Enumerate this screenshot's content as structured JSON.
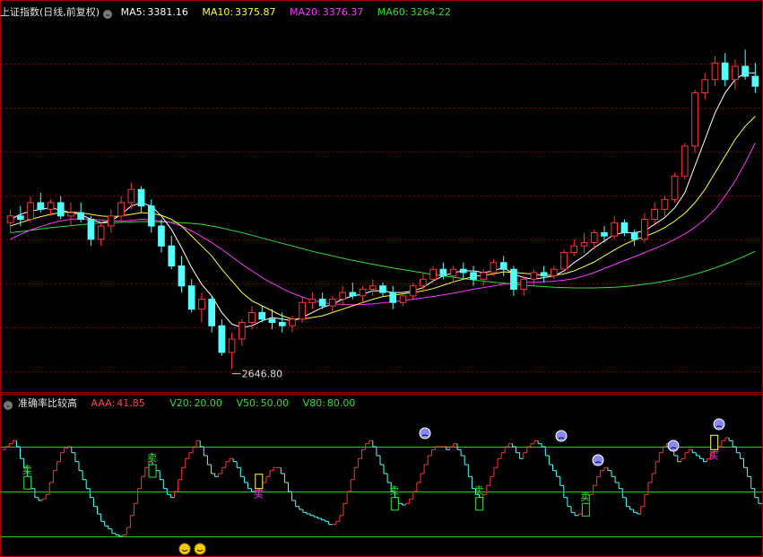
{
  "main_panel": {
    "title": "上证指数(日线,前复权)",
    "ma": [
      {
        "label": "MA5:",
        "value": "3381.16",
        "color": "#ffffff"
      },
      {
        "label": "MA10:",
        "value": "3375.87",
        "color": "#ffff33"
      },
      {
        "label": "MA20:",
        "value": "3376.37",
        "color": "#ff33ff"
      },
      {
        "label": "MA60:",
        "value": "3264.22",
        "color": "#33dd33"
      }
    ],
    "low_label": "2646.80"
  },
  "sub_panel": {
    "title": "准确率比较高",
    "indicators": [
      {
        "label": "AAA:",
        "value": "41.85",
        "color": "#ff4444"
      },
      {
        "label": "V20:",
        "value": "20.00",
        "color": "#33dd33"
      },
      {
        "label": "V50:",
        "value": "50.00",
        "color": "#33dd33"
      },
      {
        "label": "V80:",
        "value": "80.00",
        "color": "#33dd33"
      }
    ],
    "sell_text": "卖",
    "buy_text": "买"
  },
  "colors": {
    "up": "#ff3333",
    "down": "#54ffff",
    "ma5": "#ffffff",
    "ma10": "#ffff33",
    "ma20": "#ff33ff",
    "ma60": "#33dd33",
    "grid": "#8b0000",
    "border": "#a00000",
    "level": "#22cc22",
    "sell": "#33dd33",
    "buy": "#ff33ff"
  },
  "chart_data": [
    {
      "type": "candlestick",
      "title": "上证指数(日线,前复权)",
      "ylim": [
        2600,
        3700
      ],
      "low_marker": 2646.8,
      "candles": [
        [
          3090,
          3130,
          3060,
          3110
        ],
        [
          3110,
          3140,
          3080,
          3100
        ],
        [
          3100,
          3170,
          3090,
          3150
        ],
        [
          3150,
          3180,
          3120,
          3130
        ],
        [
          3130,
          3160,
          3110,
          3150
        ],
        [
          3150,
          3170,
          3100,
          3110
        ],
        [
          3110,
          3150,
          3080,
          3120
        ],
        [
          3120,
          3150,
          3090,
          3100
        ],
        [
          3100,
          3110,
          3020,
          3040
        ],
        [
          3040,
          3090,
          3020,
          3080
        ],
        [
          3080,
          3130,
          3060,
          3110
        ],
        [
          3110,
          3170,
          3090,
          3150
        ],
        [
          3150,
          3210,
          3130,
          3190
        ],
        [
          3190,
          3200,
          3120,
          3140
        ],
        [
          3140,
          3160,
          3060,
          3080
        ],
        [
          3080,
          3100,
          3000,
          3020
        ],
        [
          3020,
          3050,
          2950,
          2960
        ],
        [
          2960,
          2990,
          2880,
          2900
        ],
        [
          2900,
          2920,
          2820,
          2830
        ],
        [
          2830,
          2880,
          2790,
          2860
        ],
        [
          2860,
          2870,
          2760,
          2780
        ],
        [
          2780,
          2800,
          2690,
          2700
        ],
        [
          2700,
          2760,
          2650,
          2740
        ],
        [
          2740,
          2800,
          2720,
          2790
        ],
        [
          2790,
          2840,
          2770,
          2820
        ],
        [
          2820,
          2840,
          2790,
          2800
        ],
        [
          2800,
          2830,
          2770,
          2790
        ],
        [
          2790,
          2820,
          2760,
          2780
        ],
        [
          2780,
          2810,
          2760,
          2800
        ],
        [
          2800,
          2870,
          2790,
          2850
        ],
        [
          2850,
          2880,
          2830,
          2860
        ],
        [
          2860,
          2880,
          2830,
          2840
        ],
        [
          2840,
          2870,
          2820,
          2860
        ],
        [
          2860,
          2900,
          2840,
          2880
        ],
        [
          2880,
          2910,
          2860,
          2870
        ],
        [
          2870,
          2900,
          2850,
          2890
        ],
        [
          2890,
          2920,
          2870,
          2900
        ],
        [
          2900,
          2910,
          2870,
          2880
        ],
        [
          2880,
          2900,
          2830,
          2850
        ],
        [
          2850,
          2880,
          2840,
          2870
        ],
        [
          2870,
          2910,
          2860,
          2900
        ],
        [
          2900,
          2940,
          2880,
          2920
        ],
        [
          2920,
          2960,
          2910,
          2950
        ],
        [
          2950,
          2970,
          2920,
          2930
        ],
        [
          2930,
          2960,
          2910,
          2950
        ],
        [
          2950,
          2970,
          2920,
          2940
        ],
        [
          2940,
          2960,
          2900,
          2920
        ],
        [
          2920,
          2950,
          2900,
          2940
        ],
        [
          2940,
          2980,
          2930,
          2970
        ],
        [
          2970,
          2990,
          2930,
          2950
        ],
        [
          2950,
          2960,
          2870,
          2890
        ],
        [
          2890,
          2930,
          2870,
          2920
        ],
        [
          2920,
          2950,
          2900,
          2940
        ],
        [
          2940,
          2960,
          2910,
          2930
        ],
        [
          2930,
          2960,
          2920,
          2950
        ],
        [
          2950,
          3010,
          2940,
          3000
        ],
        [
          3000,
          3040,
          2990,
          3020
        ],
        [
          3020,
          3060,
          3000,
          3030
        ],
        [
          3030,
          3070,
          3010,
          3060
        ],
        [
          3060,
          3080,
          3030,
          3050
        ],
        [
          3050,
          3110,
          3040,
          3090
        ],
        [
          3090,
          3100,
          3050,
          3060
        ],
        [
          3060,
          3070,
          3020,
          3040
        ],
        [
          3040,
          3120,
          3030,
          3100
        ],
        [
          3100,
          3150,
          3080,
          3130
        ],
        [
          3130,
          3170,
          3110,
          3160
        ],
        [
          3160,
          3240,
          3150,
          3230
        ],
        [
          3230,
          3330,
          3220,
          3320
        ],
        [
          3320,
          3490,
          3300,
          3480
        ],
        [
          3480,
          3540,
          3460,
          3520
        ],
        [
          3520,
          3590,
          3500,
          3570
        ],
        [
          3570,
          3600,
          3500,
          3520
        ],
        [
          3520,
          3580,
          3490,
          3560
        ],
        [
          3560,
          3610,
          3520,
          3530
        ],
        [
          3530,
          3570,
          3480,
          3500
        ]
      ],
      "series": [
        {
          "name": "MA5",
          "values": [
            3100,
            3115,
            3125,
            3130,
            3135,
            3128,
            3120,
            3115,
            3100,
            3090,
            3095,
            3115,
            3140,
            3150,
            3140,
            3110,
            3070,
            3015,
            2955,
            2905,
            2870,
            2820,
            2785,
            2775,
            2780,
            2795,
            2805,
            2800,
            2795,
            2805,
            2820,
            2835,
            2845,
            2860,
            2870,
            2875,
            2885,
            2885,
            2880,
            2880,
            2885,
            2895,
            2915,
            2930,
            2940,
            2945,
            2945,
            2940,
            2945,
            2955,
            2935,
            2925,
            2920,
            2925,
            2930,
            2945,
            2970,
            2990,
            3015,
            3035,
            3055,
            3060,
            3060,
            3065,
            3085,
            3105,
            3135,
            3180,
            3260,
            3340,
            3420,
            3480,
            3520,
            3540,
            3540
          ]
        },
        {
          "name": "MA10",
          "values": [
            3080,
            3090,
            3100,
            3108,
            3115,
            3120,
            3122,
            3120,
            3115,
            3110,
            3108,
            3110,
            3115,
            3120,
            3118,
            3112,
            3100,
            3080,
            3050,
            3020,
            2990,
            2950,
            2915,
            2880,
            2855,
            2840,
            2825,
            2810,
            2800,
            2800,
            2805,
            2810,
            2820,
            2830,
            2840,
            2850,
            2860,
            2868,
            2872,
            2876,
            2880,
            2885,
            2892,
            2902,
            2912,
            2920,
            2928,
            2932,
            2936,
            2942,
            2940,
            2938,
            2935,
            2932,
            2932,
            2936,
            2945,
            2958,
            2972,
            2990,
            3008,
            3025,
            3038,
            3048,
            3060,
            3075,
            3095,
            3118,
            3150,
            3190,
            3240,
            3290,
            3340,
            3380,
            3410
          ]
        },
        {
          "name": "MA20",
          "values": [
            3040,
            3055,
            3068,
            3078,
            3088,
            3095,
            3100,
            3102,
            3100,
            3098,
            3095,
            3095,
            3097,
            3100,
            3098,
            3095,
            3090,
            3080,
            3065,
            3048,
            3030,
            3010,
            2988,
            2965,
            2945,
            2925,
            2908,
            2892,
            2878,
            2866,
            2857,
            2850,
            2846,
            2844,
            2843,
            2844,
            2846,
            2849,
            2852,
            2856,
            2860,
            2864,
            2868,
            2873,
            2878,
            2884,
            2890,
            2895,
            2900,
            2905,
            2908,
            2910,
            2911,
            2912,
            2914,
            2917,
            2922,
            2930,
            2940,
            2952,
            2964,
            2976,
            2988,
            3000,
            3012,
            3025,
            3040,
            3056,
            3076,
            3100,
            3130,
            3170,
            3215,
            3270,
            3330
          ]
        },
        {
          "name": "MA60",
          "values": [
            3060,
            3063,
            3067,
            3071,
            3075,
            3078,
            3081,
            3084,
            3087,
            3089,
            3090,
            3091,
            3092,
            3093,
            3093,
            3092,
            3091,
            3090,
            3088,
            3085,
            3080,
            3074,
            3067,
            3060,
            3052,
            3044,
            3036,
            3028,
            3020,
            3012,
            3004,
            2997,
            2990,
            2983,
            2977,
            2971,
            2965,
            2959,
            2954,
            2949,
            2944,
            2939,
            2934,
            2930,
            2926,
            2922,
            2918,
            2914,
            2911,
            2908,
            2905,
            2902,
            2900,
            2898,
            2896,
            2895,
            2894,
            2894,
            2894,
            2895,
            2896,
            2898,
            2901,
            2905,
            2909,
            2914,
            2920,
            2927,
            2935,
            2944,
            2954,
            2965,
            2977,
            2990,
            3004
          ]
        }
      ]
    },
    {
      "type": "step-line",
      "title": "准确率比较高",
      "ylim": [
        0,
        100
      ],
      "levels": [
        20,
        50,
        80
      ],
      "series": [
        {
          "name": "AAA",
          "values": [
            78,
            80,
            82,
            84,
            80,
            72,
            66,
            60,
            52,
            46,
            44,
            45,
            48,
            56,
            64,
            70,
            76,
            79,
            80,
            76,
            70,
            64,
            58,
            52,
            46,
            40,
            35,
            30,
            27,
            25,
            22,
            21,
            20,
            21,
            26,
            34,
            42,
            52,
            60,
            66,
            70,
            68,
            64,
            58,
            52,
            48,
            46,
            50,
            58,
            66,
            72,
            76,
            80,
            84,
            80,
            74,
            68,
            62,
            60,
            62,
            66,
            70,
            72,
            70,
            66,
            60,
            56,
            52,
            50,
            50,
            52,
            56,
            60,
            64,
            66,
            66,
            62,
            56,
            50,
            44,
            40,
            38,
            36,
            35,
            34,
            33,
            32,
            31,
            30,
            28,
            28,
            30,
            34,
            42,
            50,
            58,
            66,
            72,
            78,
            82,
            84,
            80,
            74,
            68,
            62,
            56,
            50,
            46,
            42,
            41,
            42,
            45,
            50,
            56,
            62,
            68,
            74,
            78,
            80,
            80,
            80,
            78,
            80,
            82,
            78,
            74,
            68,
            60,
            52,
            48,
            46,
            48,
            54,
            60,
            66,
            72,
            76,
            80,
            82,
            80,
            76,
            72,
            76,
            80,
            82,
            84,
            82,
            80,
            74,
            68,
            64,
            60,
            54,
            46,
            40,
            36,
            34,
            35,
            38,
            42,
            48,
            54,
            60,
            64,
            66,
            64,
            60,
            56,
            52,
            46,
            40,
            38,
            36,
            35,
            40,
            48,
            56,
            62,
            70,
            76,
            80,
            82,
            80,
            74,
            70,
            72,
            76,
            78,
            76,
            74,
            72,
            70,
            72,
            76,
            78,
            80,
            84,
            86,
            84,
            80,
            76,
            72,
            66,
            60,
            52,
            46,
            42
          ]
        },
        {
          "name": "V20",
          "values": [
            20
          ]
        },
        {
          "name": "V50",
          "values": [
            50
          ]
        },
        {
          "name": "V80",
          "values": [
            80
          ]
        }
      ],
      "sell_signals": [
        7,
        41,
        107,
        130,
        159,
        213,
        238,
        254
      ],
      "buy_signals": [
        70,
        194
      ]
    }
  ]
}
